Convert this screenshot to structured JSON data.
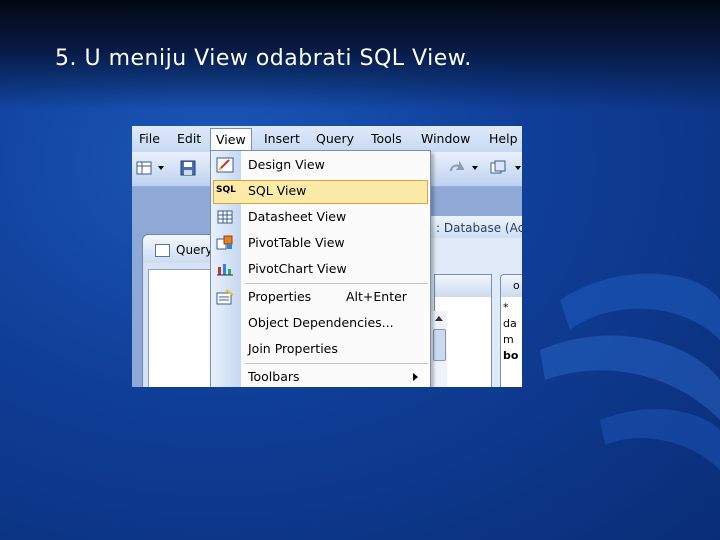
{
  "slide": {
    "title": "5. U meniju View odabrati SQL View."
  },
  "menubar": {
    "items": [
      {
        "label": "File"
      },
      {
        "label": "Edit"
      },
      {
        "label": "View"
      },
      {
        "label": "Insert"
      },
      {
        "label": "Query"
      },
      {
        "label": "Tools"
      },
      {
        "label": "Window"
      },
      {
        "label": "Help"
      }
    ],
    "active": "View"
  },
  "view_menu": {
    "items": [
      {
        "label": "Design View",
        "icon": "design-view-icon"
      },
      {
        "label": "SQL View",
        "icon": "sql-view-icon",
        "highlighted": true
      },
      {
        "label": "Datasheet View",
        "icon": "datasheet-icon"
      },
      {
        "label": "PivotTable View",
        "icon": "pivottable-icon"
      },
      {
        "label": "PivotChart View",
        "icon": "pivotchart-icon"
      },
      {
        "label": "Properties",
        "shortcut": "Alt+Enter",
        "icon": "properties-icon"
      },
      {
        "label": "Object Dependencies...",
        "icon": ""
      },
      {
        "label": "Join Properties",
        "icon": ""
      },
      {
        "label": "Toolbars",
        "icon": "",
        "submenu": true
      }
    ],
    "sql_icon_text": "SQL"
  },
  "background_window": {
    "query_tab_label": "Query",
    "db_title": ": Database (Acc",
    "table_header": "o",
    "table_columns": [
      "*",
      "da",
      "m",
      "bo"
    ]
  },
  "colors": {
    "highlight": "#fbeaa8",
    "highlight_border": "#d9a53a",
    "background": "#0f3e97"
  }
}
